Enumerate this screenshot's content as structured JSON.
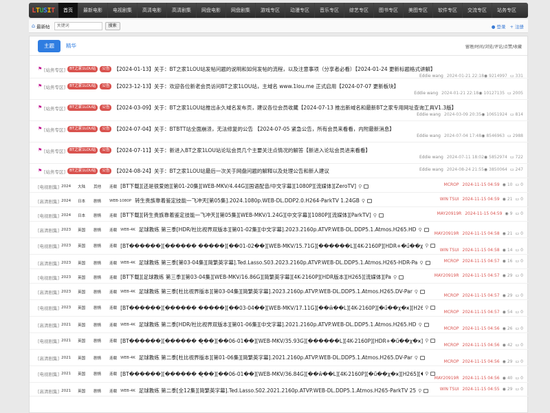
{
  "logo": {
    "text": "LTUSIT"
  },
  "nav": [
    "首页",
    "最新电影",
    "电视剧集",
    "高清电影",
    "高清剧集",
    "网盘电影",
    "网盘剧集",
    "游戏专区",
    "动漫专区",
    "音乐专区",
    "综艺专区",
    "图书专区",
    "美图专区",
    "软件专区",
    "交流专区",
    "站务专区"
  ],
  "subbar": {
    "crumb": "最新帖",
    "search_placeholder": "关键词",
    "search_button": "搜索",
    "login": "登录",
    "register": "注册"
  },
  "tabs": {
    "active": "主题",
    "other": "精华"
  },
  "sort_options": "留理/时间/浏览/评论/点赞/收藏",
  "pinned": [
    {
      "cat": "[站务专区]",
      "badges": [
        "BT之家1LOU站",
        "公告"
      ],
      "title": "【2024-01-13】关于：BT之家1LOU站发帖问题的说明和如何发帖的流程，以及注意事项（分享者必看）【2024-01-24 更新标题格式讲解】",
      "author": "Eddie wang",
      "time": "2024-01-21 22:18",
      "views": "9214997",
      "comments": "331"
    },
    {
      "cat": "[站务专区]",
      "badges": [
        "BT之家1LOU站",
        "公告"
      ],
      "title": "【2023-12-13】关于：欢迎各位新老会员访问BT之家1LOU站，主域名 www.1lou.me 正式启用【2024-07-07 更新板块】",
      "author": "Eddie wang",
      "time": "2024-01-21 22:18",
      "views": "10127135",
      "comments": "2005"
    },
    {
      "cat": "[站务专区]",
      "badges": [
        "BT之家1LOU站",
        "公告"
      ],
      "title": "【2024-03-09】关于：BT之家1LOU站推出永久域名发布页，建议各位会员收藏【2024-07-13 推出新域名和最新BT之家专用网址查询工具V1.3版】",
      "author": "Eddie wang",
      "time": "2024-03-09 20:35",
      "views": "10651924",
      "comments": "814"
    },
    {
      "cat": "[站务专区]",
      "badges": [
        "BT之家1LOU站",
        "公告"
      ],
      "title": "【2024-07-04】关于：BTBTT站全面崩溃，无法修复的公告 【2024-07-05 紧急公告，所有会员来看看，内附最新消息】",
      "author": "Eddie wang",
      "time": "2024-07-04 17:48",
      "views": "8546963",
      "comments": "2988"
    },
    {
      "cat": "[站务专区]",
      "badges": [
        "BT之家1LOU站",
        "公告"
      ],
      "title": "【2024-07-11】关于：新进入BT之家1LOU站论坛会员几个主要关注点情况的解答【新进入论坛会员进来看看】",
      "author": "Eddie wang",
      "time": "2024-07-11 18:02",
      "views": "5852974",
      "comments": "722"
    },
    {
      "cat": "[站务专区]",
      "badges": [
        "BT之家1LOU站",
        "公告"
      ],
      "title": "【2024-08-24】关于：BT之家1LOU站最后一次关于网盘问题的解释以及处理公告和新人建议",
      "author": "Eddie wang",
      "time": "2024-08-24 21:55",
      "views": "3850064",
      "comments": "247"
    }
  ],
  "threads": [
    {
      "cat": "[电视剧集]",
      "year": "2024",
      "region": "大陆",
      "type": "其他",
      "status": "连载",
      "res": "",
      "title": "[BT下载][还是很爱她][第01-20集][WEB-MKV/4.44G][国语配音/中文字幕][1080P][流媒体][ZeroTV]",
      "author": "MCROP",
      "time": "2024-11-15 04:59",
      "views": "10",
      "comments": "0"
    },
    {
      "cat": "[高清剧集]",
      "year": "2024",
      "region": "日本",
      "type": "剧情",
      "status": "WEB-1080P",
      "res": "",
      "title": "转生贵族靠着鉴定技能一飞冲天[第05集].2024.1080p.WEB-DL.DDP2.0.H264-ParkTV 1.24GB",
      "author": "WIN TSUI",
      "time": "2024-11-15 04:59",
      "views": "21",
      "comments": "0"
    },
    {
      "cat": "[电视剧集]",
      "year": "2024",
      "region": "日本",
      "type": "剧情",
      "status": "连载",
      "res": "",
      "title": "[BT下载][转生贵族靠着鉴定技能一飞冲天][第05集][WEB-MKV/1.24G][中文字幕][1080P][流媒体][ParkTV]",
      "author": "MAY20919R",
      "time": "2024-11-15 04:59",
      "views": "9",
      "comments": "0"
    },
    {
      "cat": "[高清剧集]",
      "year": "2023",
      "region": "英国",
      "type": "剧情",
      "status": "连载",
      "res": "WEB-4K",
      "title": "足球教练 第三季[HDR/杜比视界双版本][第01-02集][中文字幕].2023.2160p.ATVP.WEB-DL.DDP5.1.Atmos.H265.HD",
      "author": "MAY20919R",
      "time": "2024-11-15 04:58",
      "views": "21",
      "comments": "0"
    },
    {
      "cat": "[电视剧集]",
      "year": "2023",
      "region": "英国",
      "type": "剧情",
      "status": "连载",
      "res": "",
      "title": "[BT������][������ �����][��01-02��][WEB-MKV/15.71G][������L][4K-2160P][HDR+�ű��χ�ӿ][H265]",
      "author": "WIN TSUI",
      "time": "2024-11-15 04:58",
      "views": "14",
      "comments": "0"
    },
    {
      "cat": "[高清剧集]",
      "year": "2023",
      "region": "英国",
      "type": "剧情",
      "status": "连载",
      "res": "WEB-4K",
      "title": "足球教练 第三季[第03-04集][简繁英字幕].Ted.Lasso.S03.2023.2160p.ATVP.WEB-DL.DDP5.1.Atmos.H265-HDR-Pa",
      "author": "MCROP",
      "time": "2024-11-15 04:57",
      "views": "16",
      "comments": "0"
    },
    {
      "cat": "[电视剧集]",
      "year": "2023",
      "region": "英国",
      "type": "剧情",
      "status": "连载",
      "res": "",
      "title": "[BT下载][足球教练 第三季][第03-04集][WEB-MKV/16.86G][简繁英字幕][4K-2160P][HDR版本][H265][流媒体][Pa",
      "author": "MAY20919R",
      "time": "2024-11-15 04:57",
      "views": "29",
      "comments": "0"
    },
    {
      "cat": "[高清剧集]",
      "year": "2023",
      "region": "英国",
      "type": "剧情",
      "status": "连载",
      "res": "WEB-4K",
      "title": "足球教练 第三季[杜比视界版本][第03-04集][简繁英字幕].2023.2160p.ATVP.WEB-DL.DDP5.1.Atmos.H265.DV-Par",
      "author": "MCROP",
      "time": "2024-11-15 04:57",
      "views": "29",
      "comments": "0"
    },
    {
      "cat": "[电视剧集]",
      "year": "2023",
      "region": "英国",
      "type": "剧情",
      "status": "连载",
      "res": "",
      "title": "[BT������][������ �����][��03-04��][WEB-MKV/17.11G][��ŵ��L][4K-2160P][�ű��χ�ӿ][H265][��ӯ",
      "author": "MCROP",
      "time": "2024-11-15 04:57",
      "views": "54",
      "comments": "0"
    },
    {
      "cat": "[高清剧集]",
      "year": "2021",
      "region": "英国",
      "type": "剧情",
      "status": "连载",
      "res": "WEB-4K",
      "title": "足球教练 第二季[HDR/杜比视界双版本][第01-06集][中文字幕].2021.2160p.ATVP.WEB-DL.DDP5.1.Atmos.H265.HD",
      "author": "MCROP",
      "time": "2024-11-15 04:56",
      "views": "26",
      "comments": "0"
    },
    {
      "cat": "[电视剧集]",
      "year": "2021",
      "region": "英国",
      "type": "剧情",
      "status": "连载",
      "res": "",
      "title": "[BT������][������ �̮��][��06-01��][WEB-MKV/35.93G][������L][4K-2160P][HDR+�ű��χ�ӿ][H265]",
      "author": "MCROP",
      "time": "2024-11-15 04:56",
      "views": "42",
      "comments": "0"
    },
    {
      "cat": "[高清剧集]",
      "year": "2021",
      "region": "英国",
      "type": "剧情",
      "status": "连载",
      "res": "WEB-4K",
      "title": "足球教练 第二季[杜比视界版本][第01-06集][简繁英字幕].2021.2160p.ATVP.WEB-DL.DDP5.1.Atmos.H265.DV-Par",
      "author": "MCROP",
      "time": "2024-11-15 04:56",
      "views": "29",
      "comments": "0"
    },
    {
      "cat": "[电视剧集]",
      "year": "2021",
      "region": "英国",
      "type": "剧情",
      "status": "连载",
      "res": "",
      "title": "[BT������][������ �̮��][��06-01��][WEB-MKV/36.84G][��ŵ��L][4K-2160P][�ű��χ�ӿ][H265][��ӯ",
      "author": "MAY20919R",
      "time": "2024-11-15 04:56",
      "views": "40",
      "comments": "0"
    },
    {
      "cat": "[高清剧集]",
      "year": "2021",
      "region": "英国",
      "type": "剧情",
      "status": "连载",
      "res": "WEB-4K",
      "title": "足球教练 第二季[全12集][简繁英字幕].Ted.Lasso.S02.2021.2160p.ATVP.WEB-DL.DDP5.1.Atmos.H265-ParkTV 25",
      "author": "WIN TSUI",
      "time": "2024-11-15 04:55",
      "views": "29",
      "comments": "0"
    }
  ],
  "colors": {
    "accent": "#2f7de1",
    "badge": "#d9534f",
    "flag": "#c0138f",
    "nav_bg": "#333333"
  }
}
